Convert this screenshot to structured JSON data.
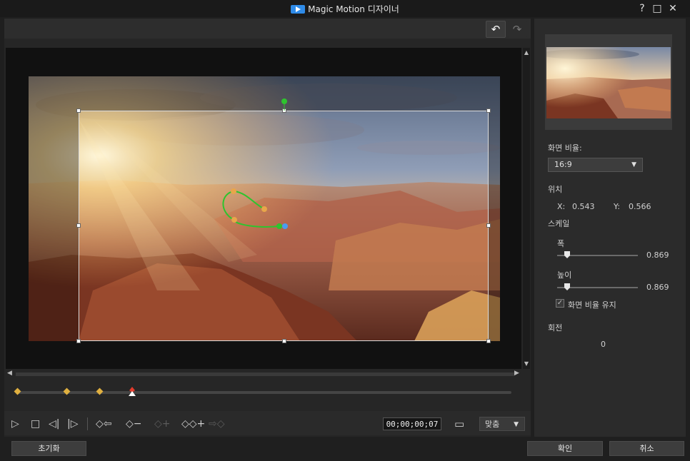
{
  "window": {
    "title": "Magic Motion 디자이너",
    "help": "?",
    "maximize": "□",
    "close": "✕"
  },
  "toolbar": {
    "undo": "↶",
    "redo": "↷"
  },
  "playback": {
    "play": "▷",
    "stop": "□",
    "prev_frame": "◁|",
    "next_frame": "|▷",
    "prev_keyframe": "◇⇦",
    "remove_keyframe": "◇−",
    "add_keyframe_disabled": "◇+",
    "add_keyframe": "◇◇+",
    "next_keyframe": "⇨◇",
    "timecode": "00;00;00;07",
    "safe_zone": "▭",
    "fit": "맞춤"
  },
  "timeline": {
    "keyframe_count": 3,
    "playhead_color": "#e33b2c"
  },
  "settings": {
    "aspect_label": "화면 비율:",
    "aspect_value": "16:9",
    "position_label": "위치",
    "x_label": "X:",
    "x_value": "0.543",
    "y_label": "Y:",
    "y_value": "0.566",
    "scale_label": "스케일",
    "width_label": "폭",
    "width_value": "0.869",
    "height_label": "높이",
    "height_value": "0.869",
    "keep_ratio_label": "화면 비율 유지",
    "keep_ratio_checked": true,
    "rotation_label": "회전",
    "rotation_value": "0"
  },
  "footer": {
    "reset": "초기화",
    "ok": "확인",
    "cancel": "취소"
  },
  "colors": {
    "accent": "#2f8be8",
    "path": "#2ec42e",
    "keyframe": "#e0b040"
  }
}
